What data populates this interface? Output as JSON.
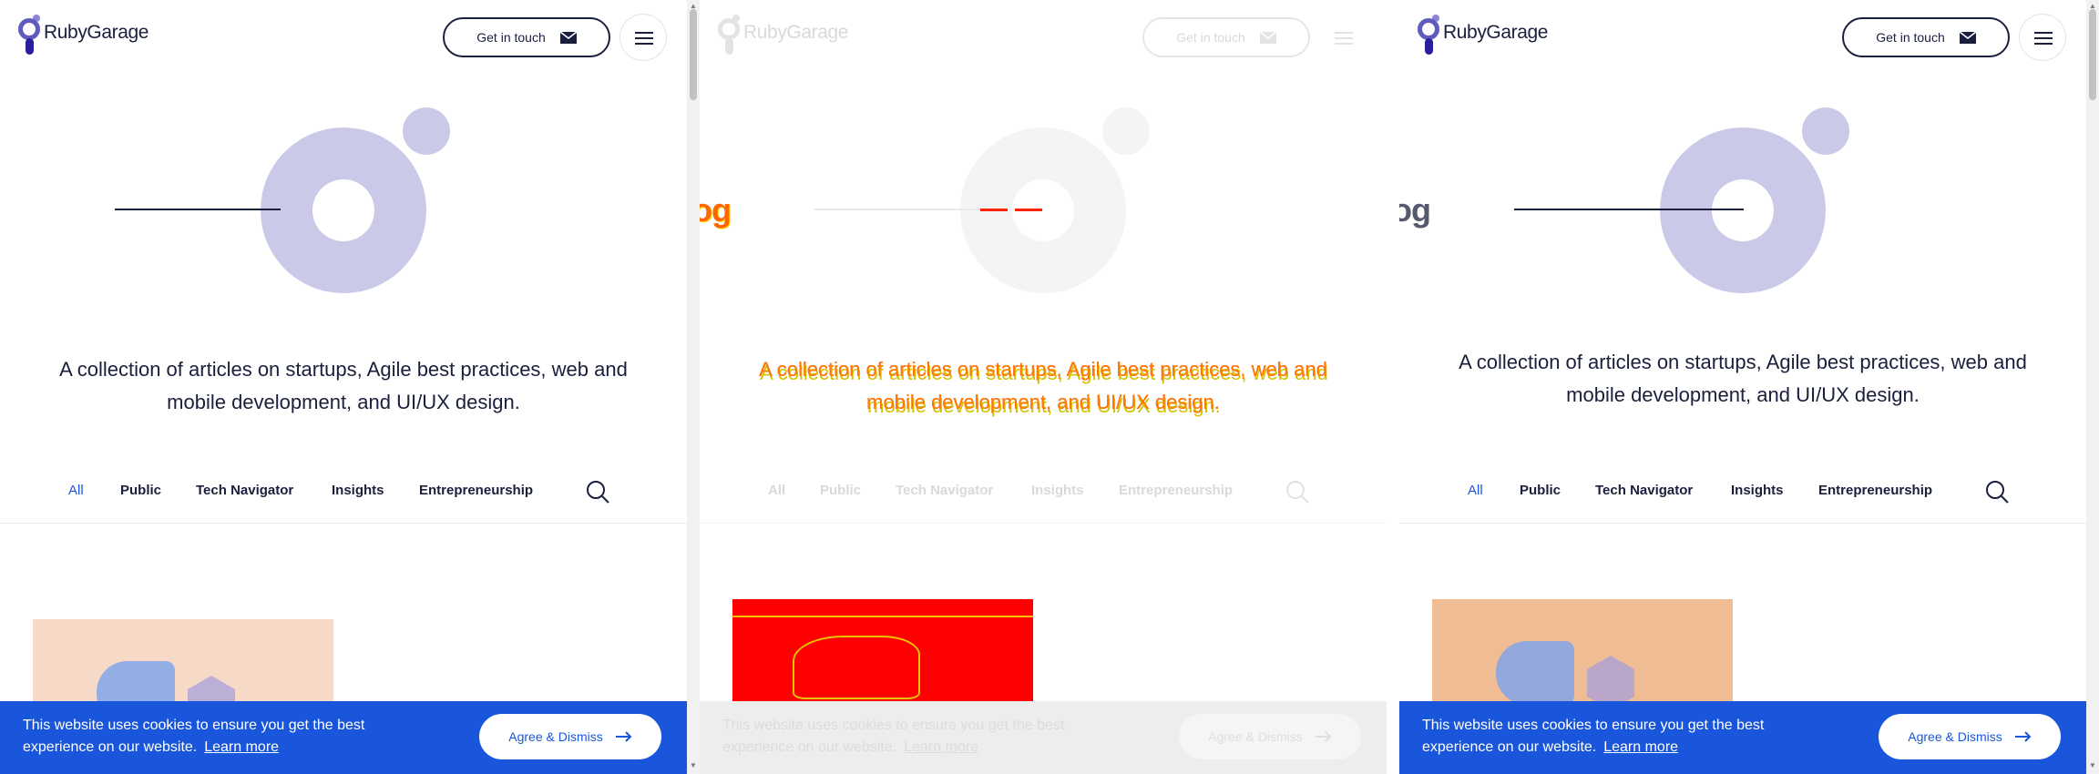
{
  "brand": {
    "name": "RubyGarage"
  },
  "header": {
    "get_in_touch": "Get in touch"
  },
  "hero": {
    "blog_fragment": "og"
  },
  "description": "A collection of articles on startups, Agile best practices, web and mobile development, and UI/UX design.",
  "categories": {
    "all": "All",
    "public": "Public",
    "tech_navigator": "Tech Navigator",
    "insights": "Insights",
    "entrepreneurship": "Entrepreneurship"
  },
  "cookie": {
    "message": "This website uses cookies to ensure you get the best experience on our website.",
    "learn_more": "Learn more",
    "agree": "Agree & Dismiss"
  },
  "icons": {
    "envelope": "envelope-icon",
    "menu": "hamburger-icon",
    "search": "search-icon",
    "arrow": "arrow-right-icon"
  },
  "colors": {
    "navy": "#1a1f3d",
    "accent_blue": "#1a56db",
    "lavender": "#cbc9e8",
    "diff_red": "#ff0000",
    "diff_yellow": "#ffd800"
  }
}
